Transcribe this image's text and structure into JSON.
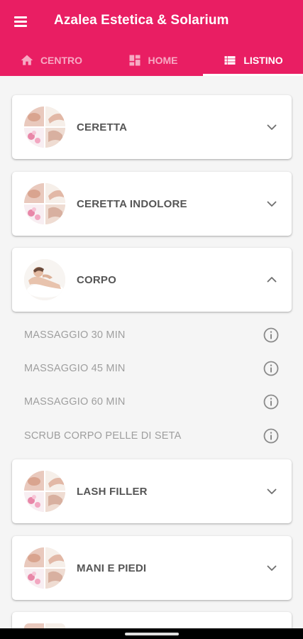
{
  "app": {
    "title": "Azalea Estetica & Solarium",
    "accent_color": "#e91e63"
  },
  "tabs": [
    {
      "label": "CENTRO",
      "icon": "home-icon",
      "active": false
    },
    {
      "label": "HOME",
      "icon": "dashboard-icon",
      "active": false
    },
    {
      "label": "LISTINO",
      "icon": "list-icon",
      "active": true
    }
  ],
  "categories": [
    {
      "label": "CERETTA",
      "thumb_icon": "collage-thumbnail",
      "expanded": false
    },
    {
      "label": "CERETTA INDOLORE",
      "thumb_icon": "collage-thumbnail",
      "expanded": false
    },
    {
      "label": "CORPO",
      "thumb_icon": "massage-thumbnail",
      "expanded": true,
      "items": [
        {
          "label": "MASSAGGIO 30 MIN",
          "icon": "info-icon"
        },
        {
          "label": "MASSAGGIO 45 MIN",
          "icon": "info-icon"
        },
        {
          "label": "MASSAGGIO 60 MIN",
          "icon": "info-icon"
        },
        {
          "label": "SCRUB CORPO PELLE DI SETA",
          "icon": "info-icon"
        }
      ]
    },
    {
      "label": "LASH FILLER",
      "thumb_icon": "collage-thumbnail",
      "expanded": false
    },
    {
      "label": "MANI E PIEDI",
      "thumb_icon": "collage-thumbnail",
      "expanded": false
    }
  ]
}
